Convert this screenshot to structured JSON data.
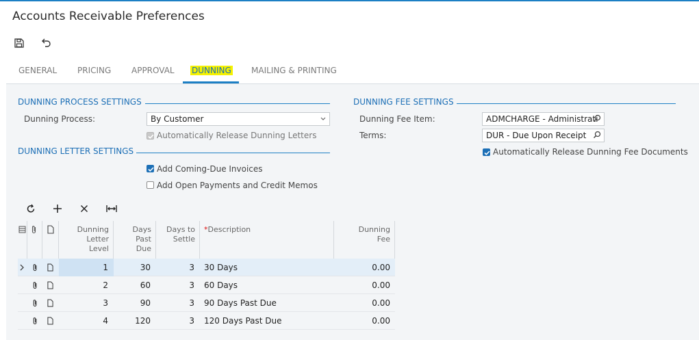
{
  "page": {
    "title": "Accounts Receivable Preferences"
  },
  "toolbar": {
    "save_icon": "save-icon",
    "undo_icon": "undo-icon"
  },
  "tabs": [
    {
      "label": "GENERAL"
    },
    {
      "label": "PRICING"
    },
    {
      "label": "APPROVAL"
    },
    {
      "label": "DUNNING",
      "active": true
    },
    {
      "label": "MAILING & PRINTING"
    }
  ],
  "dunning_process": {
    "section_title": "DUNNING PROCESS SETTINGS",
    "process_label": "Dunning Process:",
    "process_value": "By Customer",
    "auto_release_letters_label": "Automatically Release Dunning Letters",
    "auto_release_letters_checked": true
  },
  "dunning_letter": {
    "section_title": "DUNNING LETTER SETTINGS",
    "add_coming_due_label": "Add Coming-Due Invoices",
    "add_coming_due_checked": true,
    "add_open_payments_label": "Add Open Payments and Credit Memos",
    "add_open_payments_checked": false
  },
  "dunning_fee": {
    "section_title": "DUNNING FEE SETTINGS",
    "fee_item_label": "Dunning Fee Item:",
    "fee_item_value": "ADMCHARGE - Administrati",
    "terms_label": "Terms:",
    "terms_value": "DUR - Due Upon Receipt",
    "auto_release_fee_label": "Automatically Release Dunning Fee Documents",
    "auto_release_fee_checked": true
  },
  "grid": {
    "toolbar_icons": [
      "refresh-icon",
      "add-icon",
      "delete-icon",
      "fit-columns-icon"
    ],
    "columns": {
      "level_l1": "Dunning",
      "level_l2": "Letter",
      "level_l3": "Level",
      "days_l1": "Days",
      "days_l2": "Past",
      "days_l3": "Due",
      "settle_l1": "Days to",
      "settle_l2": "Settle",
      "desc_required": "*",
      "desc": "Description",
      "fee_l1": "Dunning",
      "fee_l2": "Fee"
    },
    "rows": [
      {
        "level": "1",
        "days_past_due": "30",
        "days_to_settle": "3",
        "description": "30 Days",
        "fee": "0.00"
      },
      {
        "level": "2",
        "days_past_due": "60",
        "days_to_settle": "3",
        "description": "60 Days",
        "fee": "0.00"
      },
      {
        "level": "3",
        "days_past_due": "90",
        "days_to_settle": "3",
        "description": "90 Days Past Due",
        "fee": "0.00"
      },
      {
        "level": "4",
        "days_past_due": "120",
        "days_to_settle": "3",
        "description": "120 Days Past Due",
        "fee": "0.00"
      }
    ]
  },
  "colors": {
    "accent": "#1c6fb6",
    "tab_highlight": "#f6f200",
    "selected_row": "#e3eef8"
  }
}
